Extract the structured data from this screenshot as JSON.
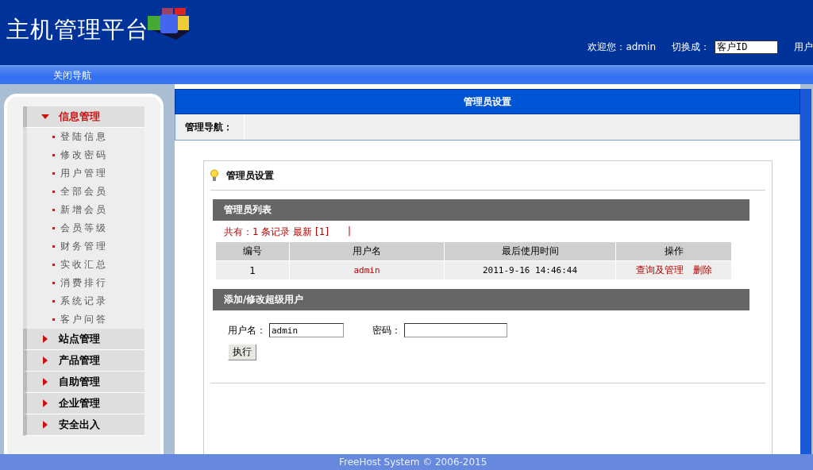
{
  "header": {
    "title": "主机管理平台",
    "welcome": "欢迎您：admin",
    "switch_label": "切换成：",
    "switch_value": "客户ID",
    "trailing": "用户"
  },
  "nav_bar": {
    "toggle": "关闭导航"
  },
  "sidebar": {
    "sections": [
      {
        "label": "信息管理",
        "expanded": true,
        "children": [
          {
            "label": "登陆信息"
          },
          {
            "label": "修改密码"
          },
          {
            "label": "用户管理"
          },
          {
            "label": "全部会员"
          },
          {
            "label": "新增会员"
          },
          {
            "label": "会员等级"
          },
          {
            "label": "财务管理"
          },
          {
            "label": "实收汇总"
          },
          {
            "label": "消费排行"
          },
          {
            "label": "系统记录"
          },
          {
            "label": "客户问答"
          }
        ]
      },
      {
        "label": "站点管理",
        "expanded": false
      },
      {
        "label": "产品管理",
        "expanded": false
      },
      {
        "label": "自助管理",
        "expanded": false
      },
      {
        "label": "企业管理",
        "expanded": false
      },
      {
        "label": "安全出入",
        "expanded": false
      }
    ]
  },
  "main": {
    "title": "管理员设置",
    "breadcrumb_label": "管理导航：",
    "panel": {
      "title": "管理员设置",
      "list": {
        "header": "管理员列表",
        "summary": "共有：1 条记录 最新 [1]",
        "separator": "|",
        "columns": [
          "编号",
          "用户名",
          "最后使用时间",
          "操作"
        ],
        "rows": [
          {
            "id": "1",
            "username": "admin",
            "last_used": "2011-9-16 14:46:44",
            "actions": [
              "查询及管理",
              "删除"
            ]
          }
        ]
      },
      "form": {
        "header": "添加/修改超级用户",
        "username_label": "用户名：",
        "username_value": "admin",
        "password_label": "密码：",
        "submit": "执行"
      }
    }
  },
  "footer": "FreeHost System © 2006-2015"
}
